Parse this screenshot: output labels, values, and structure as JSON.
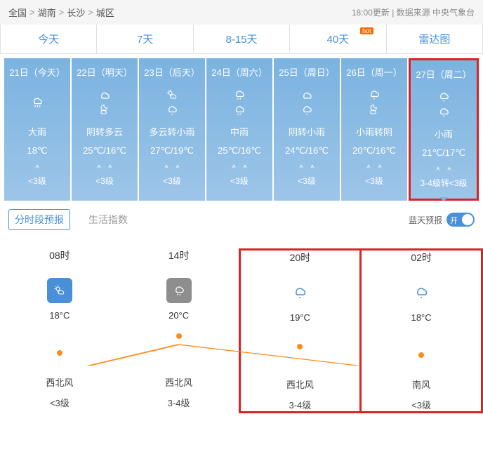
{
  "breadcrumb": [
    "全国",
    "湖南",
    "长沙",
    "城区"
  ],
  "updated": "18:00更新",
  "source": "数据来源 中央气象台",
  "tabs": [
    {
      "label": "今天"
    },
    {
      "label": "7天"
    },
    {
      "label": "8-15天"
    },
    {
      "label": "40天",
      "hot": true
    },
    {
      "label": "雷达图"
    }
  ],
  "days": [
    {
      "date": "21日（今天）",
      "weather": "大雨",
      "temp": "18℃",
      "wind": "<3级",
      "icons": [
        "heavy-rain"
      ],
      "arrows": 1
    },
    {
      "date": "22日（明天）",
      "weather": "阴转多云",
      "temp": "25℃/16℃",
      "wind": "<3级",
      "icons": [
        "cloud",
        "cloud-moon"
      ],
      "arrows": 2
    },
    {
      "date": "23日（后天）",
      "weather": "多云转小雨",
      "temp": "27℃/19℃",
      "wind": "<3级",
      "icons": [
        "sun-cloud",
        "light-rain"
      ],
      "arrows": 2
    },
    {
      "date": "24日（周六）",
      "weather": "中雨",
      "temp": "25℃/16℃",
      "wind": "<3级",
      "icons": [
        "rain",
        "rain"
      ],
      "arrows": 2
    },
    {
      "date": "25日（周日）",
      "weather": "阴转小雨",
      "temp": "24℃/16℃",
      "wind": "<3级",
      "icons": [
        "cloud",
        "light-rain"
      ],
      "arrows": 2
    },
    {
      "date": "26日（周一）",
      "weather": "小雨转阴",
      "temp": "20℃/16℃",
      "wind": "<3级",
      "icons": [
        "light-rain",
        "cloud-moon"
      ],
      "arrows": 2
    },
    {
      "date": "27日（周二）",
      "weather": "小雨",
      "temp": "21℃/17℃",
      "wind": "3-4级转<3级",
      "icons": [
        "light-rain",
        "light-rain"
      ],
      "arrows": 2,
      "selected": true
    }
  ],
  "subtabs": {
    "hourly": "分时段预报",
    "life": "生活指数"
  },
  "blueSky": {
    "label": "蓝天预报",
    "on": "开"
  },
  "hourly": [
    {
      "time": "08时",
      "temp": "18°C",
      "wind": "西北风",
      "level": "<3级",
      "icon": "sun-cloud-box",
      "boxcolor": "#4a90d9"
    },
    {
      "time": "14时",
      "temp": "20°C",
      "wind": "西北风",
      "level": "3-4级",
      "icon": "rain-box",
      "boxcolor": "#8e8e8e"
    },
    {
      "time": "20时",
      "temp": "19°C",
      "wind": "西北风",
      "level": "3-4级",
      "icon": "rain",
      "hl": true
    },
    {
      "time": "02时",
      "temp": "18°C",
      "wind": "南风",
      "level": "<3级",
      "icon": "rain",
      "hl": true
    }
  ],
  "chart_data": {
    "type": "line",
    "categories": [
      "08时",
      "14时",
      "20时",
      "02时"
    ],
    "values": [
      18,
      20,
      19,
      18
    ],
    "ylabel": "°C",
    "ylim": [
      17,
      21
    ],
    "title": "",
    "xlabel": ""
  }
}
